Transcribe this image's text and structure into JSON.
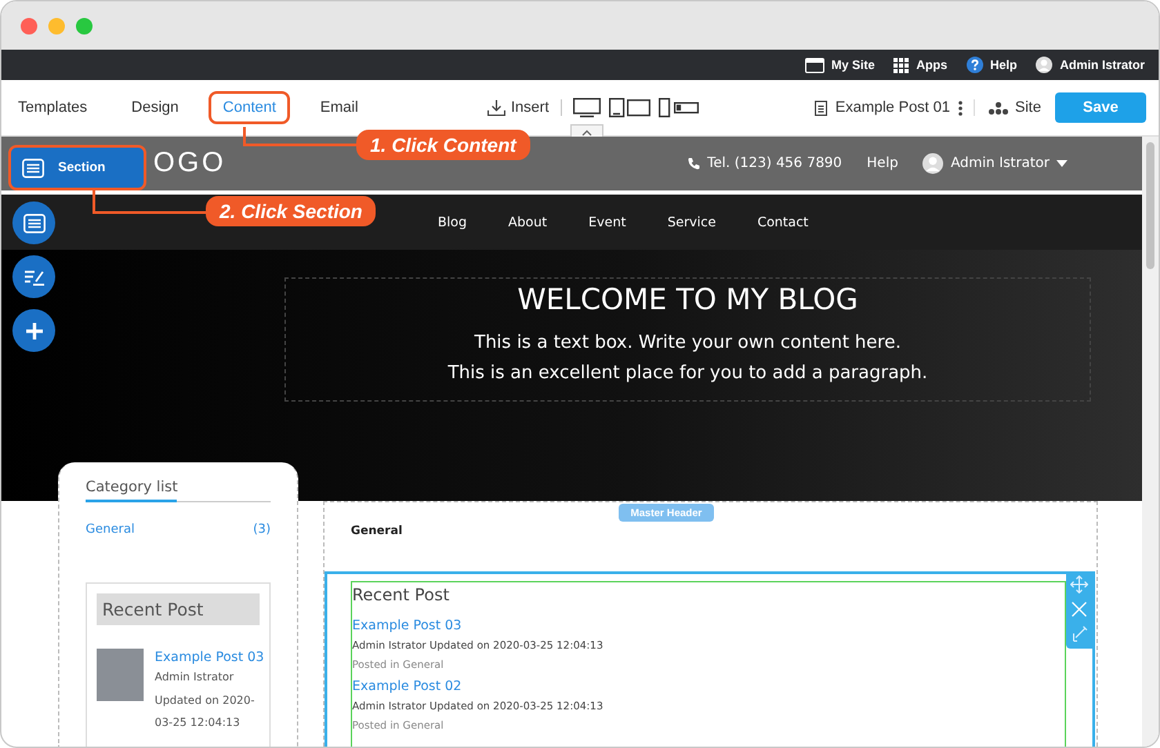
{
  "top_bar": {
    "links": [
      {
        "kind": "site",
        "label": "My Site"
      },
      {
        "kind": "apps",
        "label": "Apps"
      },
      {
        "kind": "help",
        "label": "Help"
      },
      {
        "kind": "user",
        "label": "Admin Istrator"
      }
    ]
  },
  "editor_tabs": [
    {
      "label": "Templates",
      "selected": false
    },
    {
      "label": "Design",
      "selected": false
    },
    {
      "label": "Content",
      "selected": true
    },
    {
      "label": "Email",
      "selected": false
    }
  ],
  "toolbar": {
    "insert": "Insert",
    "page": "Example Post 01",
    "site": "Site",
    "save": "Save"
  },
  "section_button": {
    "label": "Section"
  },
  "site": {
    "logo": "OGO",
    "phone": "Tel. (123) 456 7890",
    "help": "Help",
    "user": "Admin Istrator",
    "nav": [
      "Blog",
      "About",
      "Event",
      "Service",
      "Contact"
    ],
    "hero": {
      "title": "WELCOME TO MY BLOG",
      "lines": [
        "This is a text box. Write your own content here.",
        "This is an excellent place for you to add a paragraph."
      ]
    }
  },
  "sidebar": {
    "title": "Category list",
    "categories": [
      {
        "name": "General",
        "count": "(3)"
      }
    ],
    "recent": {
      "title": "Recent Post",
      "posts": [
        {
          "title": "Example Post 03",
          "author": "Admin Istrator",
          "updated": "Updated on 2020-03-25 12:04:13"
        }
      ]
    }
  },
  "main": {
    "badge": "Master Header",
    "category": "General",
    "recent": {
      "title": "Recent Post",
      "posts": [
        {
          "title": "Example Post 03",
          "meta": "Admin Istrator Updated on 2020-03-25 12:04:13",
          "category": "Posted in General"
        },
        {
          "title": "Example Post 02",
          "meta": "Admin Istrator Updated on 2020-03-25 12:04:13",
          "category": "Posted in General"
        }
      ]
    }
  },
  "callouts": [
    {
      "text": "1. Click Content"
    },
    {
      "text": "2. Click Section"
    }
  ]
}
